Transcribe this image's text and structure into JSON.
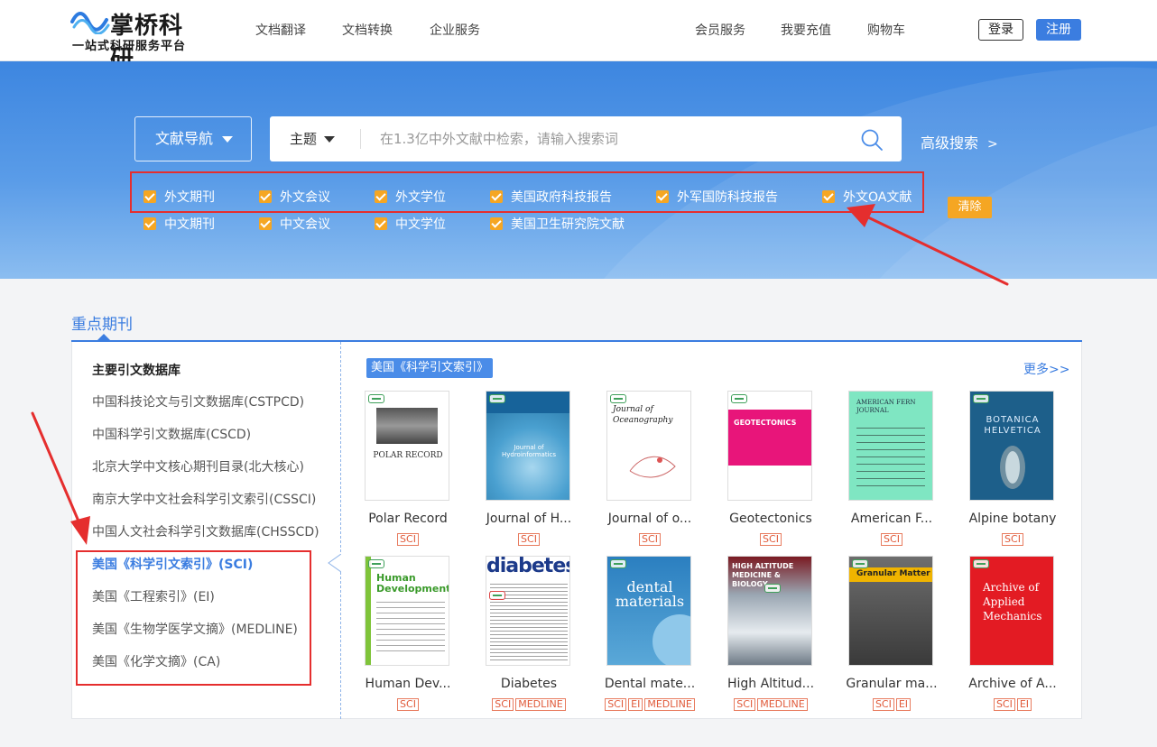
{
  "brand": {
    "title": "掌桥科研",
    "subtitle": "一站式科研服务平台"
  },
  "nav": {
    "left": [
      "文档翻译",
      "文档转换",
      "企业服务"
    ],
    "right": [
      "会员服务",
      "我要充值",
      "购物车"
    ],
    "login": "登录",
    "register": "注册"
  },
  "search": {
    "nav_dropdown": "文献导航",
    "type_dropdown": "主题",
    "placeholder": "在1.3亿中外文献中检索，请输入搜索词",
    "advanced": "高级搜索",
    "advanced_arrow": ">",
    "filters_row1": [
      "外文期刊",
      "外文会议",
      "外文学位",
      "美国政府科技报告",
      "外军国防科技报告",
      "外文OA文献"
    ],
    "filters_row2": [
      "中文期刊",
      "中文会议",
      "中文学位",
      "美国卫生研究院文献"
    ],
    "clear": "清除"
  },
  "section": {
    "title": "重点期刊"
  },
  "databases": {
    "heading": "主要引文数据库",
    "items": [
      "中国科技论文与引文数据库(CSTPCD)",
      "中国科学引文数据库(CSCD)",
      "北京大学中文核心期刊目录(北大核心)",
      "南京大学中文社会科学引文索引(CSSCI)",
      "中国人文社会科学引文数据库(CHSSCD)",
      "美国《科学引文索引》(SCI)",
      "美国《工程索引》(EI)",
      "美国《生物学医学文摘》(MEDLINE)",
      "美国《化学文摘》(CA)"
    ],
    "active_index": 5
  },
  "journals": {
    "tag": "美国《科学引文索引》",
    "more": "更多>>",
    "items": [
      {
        "title": "Polar Record",
        "badges": [
          "SCI"
        ],
        "cover_text": "POLAR RECORD"
      },
      {
        "title": "Journal of H...",
        "badges": [
          "SCI"
        ],
        "cover_text": "Journal of Hydroinformatics"
      },
      {
        "title": "Journal of o...",
        "badges": [
          "SCI"
        ],
        "cover_text": "Journal of Oceanography"
      },
      {
        "title": "Geotectonics",
        "badges": [
          "SCI"
        ],
        "cover_text": "GEOTECTONICS"
      },
      {
        "title": "American F...",
        "badges": [
          "SCI"
        ],
        "cover_text": "AMERICAN FERN JOURNAL"
      },
      {
        "title": "Alpine botany",
        "badges": [
          "SCI"
        ],
        "cover_text": "BOTANICA HELVETICA"
      },
      {
        "title": "Human Dev...",
        "badges": [
          "SCI"
        ],
        "cover_text": "Human Development"
      },
      {
        "title": "Diabetes",
        "badges": [
          "SCI",
          "MEDLINE"
        ],
        "cover_text": "diabetes"
      },
      {
        "title": "Dental mate...",
        "badges": [
          "SCI",
          "EI",
          "MEDLINE"
        ],
        "cover_text": "dental materials"
      },
      {
        "title": "High Altitud...",
        "badges": [
          "SCI",
          "MEDLINE"
        ],
        "cover_text": "HIGH ALTITUDE MEDICINE & BIOLOGY"
      },
      {
        "title": "Granular ma...",
        "badges": [
          "SCI",
          "EI"
        ],
        "cover_text": "Granular Matter"
      },
      {
        "title": "Archive of A...",
        "badges": [
          "SCI",
          "EI"
        ],
        "cover_text": "Archive of Applied Mechanics"
      }
    ]
  },
  "colors": {
    "primary": "#3b7de0",
    "accent": "#f5a623",
    "annotation": "#e52e2e",
    "badge": "#e05a3a"
  }
}
